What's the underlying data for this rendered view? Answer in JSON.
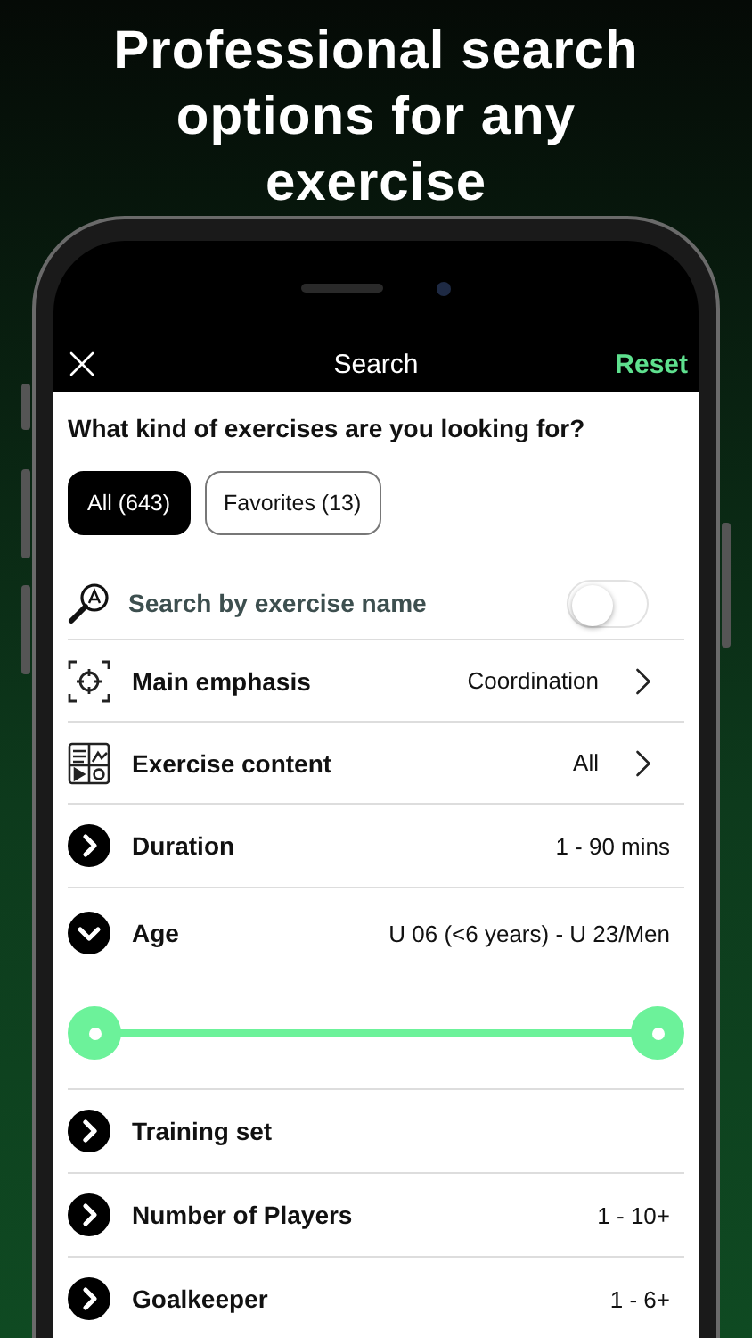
{
  "headline": "Professional search options for any exercise",
  "nav": {
    "title": "Search",
    "action": "Reset"
  },
  "question": "What kind of exercises are you looking for?",
  "filters": [
    {
      "label": "All (643)",
      "selected": true
    },
    {
      "label": "Favorites (13)",
      "selected": false
    }
  ],
  "name_search": {
    "label": "Search by exercise name",
    "on": false
  },
  "rows": [
    {
      "kind": "link",
      "label": "Main emphasis",
      "value": "Coordination"
    },
    {
      "kind": "link",
      "label": "Exercise content",
      "value": "All"
    },
    {
      "kind": "expand",
      "label": "Duration",
      "value": "1 - 90 mins",
      "expanded": false
    },
    {
      "kind": "expand",
      "label": "Age",
      "value": "U 06 (<6 years) - U 23/Men",
      "expanded": true,
      "slider": {
        "level": 1
      }
    },
    {
      "kind": "expand",
      "label": "Training set",
      "expanded": false
    },
    {
      "kind": "expand",
      "label": "Number of Players",
      "value": "1 - 10+",
      "expanded": false
    },
    {
      "kind": "expand",
      "label": "Goalkeeper",
      "value": "1 - 6+",
      "expanded": false
    }
  ]
}
